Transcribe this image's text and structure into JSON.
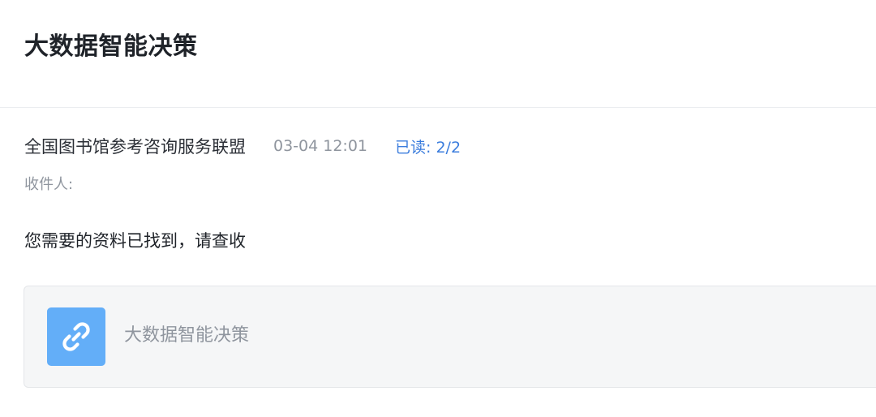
{
  "header": {
    "title": "大数据智能决策"
  },
  "message": {
    "sender": "全国图书馆参考咨询服务联盟",
    "timestamp": "03-04 12:01",
    "read_status": "已读: 2/2",
    "recipient_label": "收件人:",
    "body": "您需要的资料已找到，请查收"
  },
  "attachment": {
    "icon": "link-icon",
    "icon_color": "#63aef8",
    "title": "大数据智能决策"
  }
}
